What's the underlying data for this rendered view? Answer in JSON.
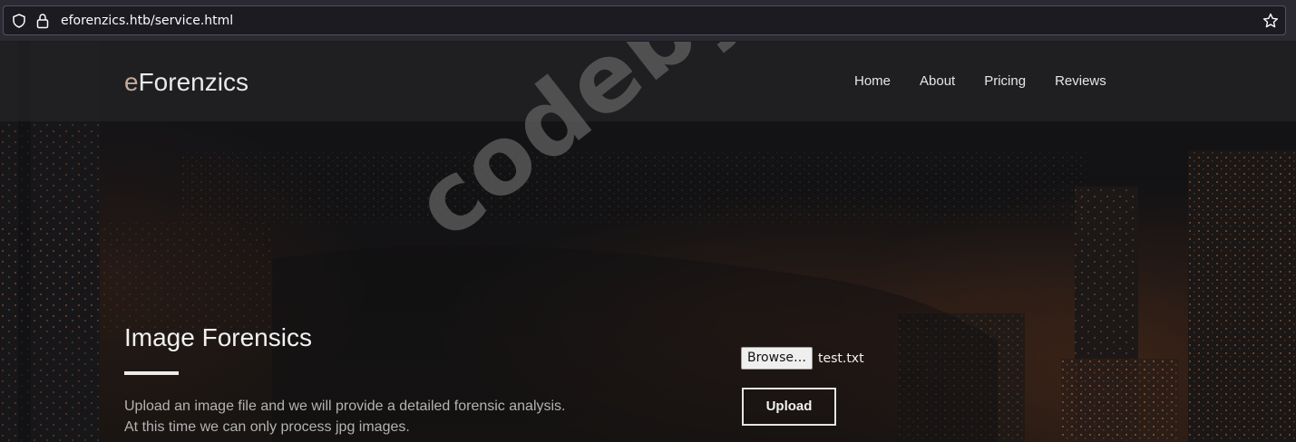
{
  "browser": {
    "url": "eforenzics.htb/service.html",
    "icons": [
      "shield-icon",
      "lock-icon",
      "star-icon"
    ]
  },
  "site": {
    "brand_first": "e",
    "brand_rest": "Forenzics",
    "nav": [
      {
        "label": "Home"
      },
      {
        "label": "About"
      },
      {
        "label": "Pricing"
      },
      {
        "label": "Reviews"
      }
    ],
    "brand_accent_color": "#c2a999"
  },
  "main": {
    "title": "Image Forensics",
    "description_line1": "Upload an image file and we will provide a detailed forensic analysis.",
    "description_line2": "At this time we can only process jpg images.",
    "file_input": {
      "browse_label": "Browse…",
      "file_name": "test.txt"
    },
    "upload_label": "Upload"
  },
  "watermark": "codeby.net"
}
